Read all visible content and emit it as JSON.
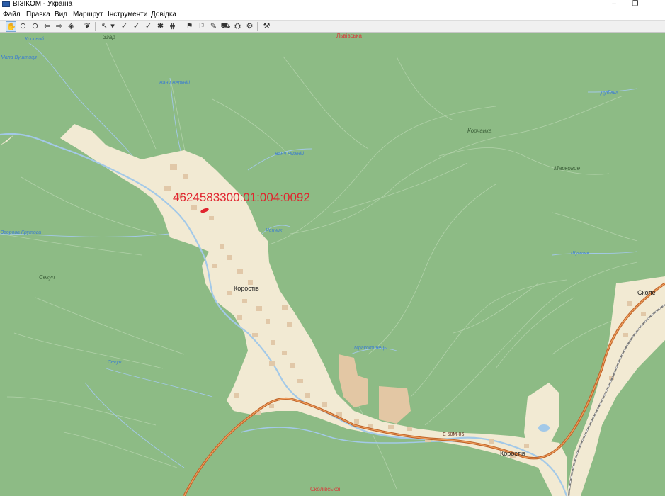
{
  "window": {
    "title": "ВІЗІКОМ - Україна",
    "controls": [
      "–",
      "❐"
    ]
  },
  "menu": {
    "items": [
      "Файл",
      "Правка",
      "Вид",
      "Маршрут",
      "Інструменти",
      "Довідка"
    ]
  },
  "toolbar": {
    "buttons": [
      {
        "name": "pan-tool",
        "glyph": "✋"
      },
      {
        "name": "zoom-in",
        "glyph": "⊕"
      },
      {
        "name": "zoom-out",
        "glyph": "⊖"
      },
      {
        "name": "back",
        "glyph": "⇦"
      },
      {
        "name": "forward",
        "glyph": "⇨"
      },
      {
        "name": "full-extent",
        "glyph": "◈"
      },
      {
        "name": "locate",
        "glyph": "❦"
      },
      {
        "name": "select",
        "glyph": "↖"
      },
      {
        "name": "select-menu",
        "glyph": "▾"
      },
      {
        "name": "route-start",
        "glyph": "✓"
      },
      {
        "name": "route-via",
        "glyph": "✓"
      },
      {
        "name": "route-end",
        "glyph": "✓"
      },
      {
        "name": "route-clear",
        "glyph": "✱"
      },
      {
        "name": "route-options",
        "glyph": "⋕"
      },
      {
        "name": "poi-1",
        "glyph": "⚑"
      },
      {
        "name": "poi-2",
        "glyph": "⚐"
      },
      {
        "name": "poi-3",
        "glyph": "✎"
      },
      {
        "name": "poi-4",
        "glyph": "⛟"
      },
      {
        "name": "poi-5",
        "glyph": "⛭"
      },
      {
        "name": "poi-6",
        "glyph": "⚙"
      },
      {
        "name": "settings",
        "glyph": "⚒"
      }
    ]
  },
  "map": {
    "cadastral_number": "4624583300:01:004:0092",
    "towns": {
      "korostiv": "Коростів",
      "skole": "Сколе"
    },
    "road": {
      "shield": "Е 50М-06",
      "top_road": "Львівська",
      "bottom_road": "Сколівської"
    },
    "streams": {
      "krosnyi": "Кросний",
      "malo_vyshnia": "Мала Вуштиця",
      "vanch_verkh": "Ванч Верхній",
      "vanch_nyzh": "Ванч Нижній",
      "zvorova": "Зворова Крутова",
      "chenchik": "Ченчик",
      "sekup_stream": "Секуп",
      "mrakotynets": "Мракотинець",
      "dubovka": "Дубівка",
      "shumlyak": "Шумляк"
    },
    "peaks": {
      "zgar": "Згар",
      "korchanka": "Корчанка",
      "markovtse": "Марковце",
      "sekup": "Секуп"
    },
    "colors": {
      "forest": "#8dbb85",
      "settlement": "#f2ead3",
      "water": "#a3c9e8",
      "road": "#e07830",
      "parcel": "#e0242e"
    }
  }
}
